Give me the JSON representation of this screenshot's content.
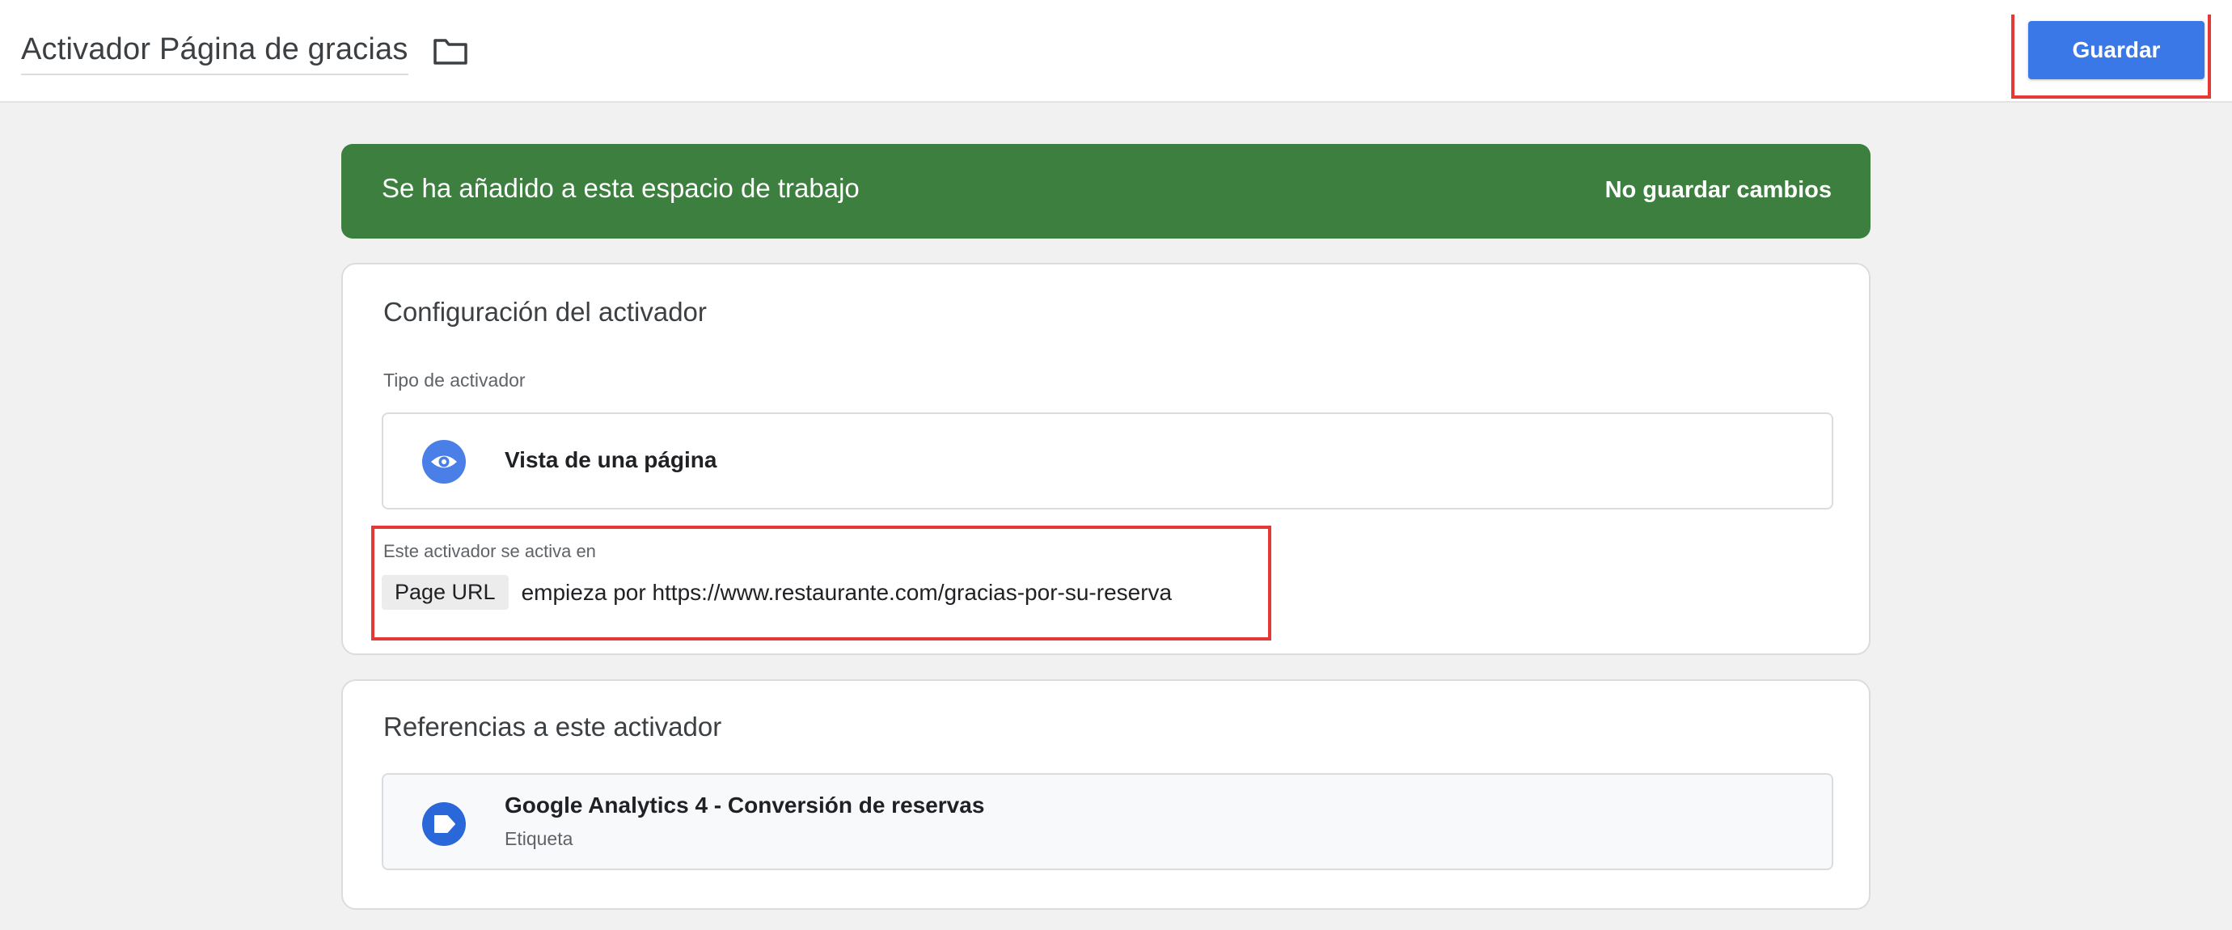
{
  "header": {
    "title": "Activador Página de gracias",
    "folder_icon": "folder-icon",
    "save_label": "Guardar"
  },
  "banner": {
    "message": "Se ha añadido a esta espacio de trabajo",
    "action": "No guardar cambios",
    "color": "#3c7f3f"
  },
  "config": {
    "title": "Configuración del activador",
    "type_label": "Tipo de activador",
    "type": {
      "name": "Vista de una página",
      "icon": "eye-icon"
    },
    "condition": {
      "label": "Este activador se activa en",
      "variable": "Page URL",
      "text": "empieza por https://www.restaurante.com/gracias-por-su-reserva"
    }
  },
  "references": {
    "title": "Referencias a este activador",
    "items": [
      {
        "name": "Google Analytics 4 - Conversión de reservas",
        "type": "Etiqueta",
        "icon": "tag-icon"
      }
    ]
  },
  "colors": {
    "accent": "#3b78e7",
    "highlight": "#e53935"
  }
}
